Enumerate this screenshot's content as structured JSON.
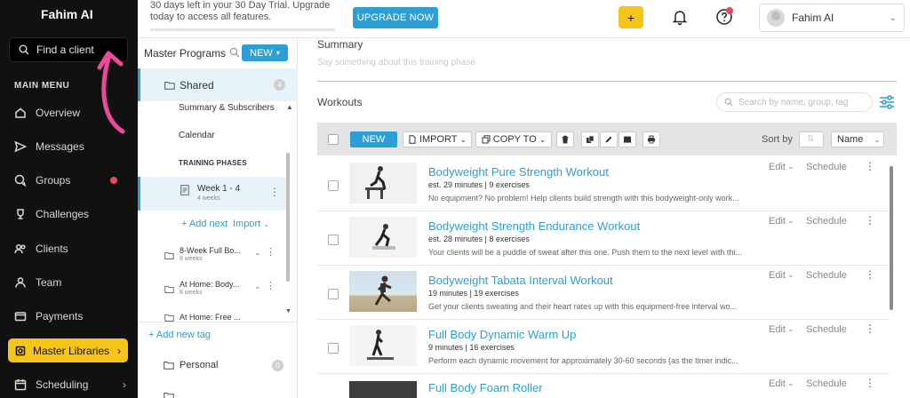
{
  "app": {
    "brand": "Fahim AI"
  },
  "sidebar": {
    "search_placeholder": "Find a client",
    "menu_heading": "MAIN MENU",
    "items": [
      {
        "label": "Overview",
        "icon": "home-icon"
      },
      {
        "label": "Messages",
        "icon": "send-icon"
      },
      {
        "label": "Groups",
        "icon": "chat-icon"
      },
      {
        "label": "Challenges",
        "icon": "trophy-icon"
      },
      {
        "label": "Clients",
        "icon": "users-icon"
      },
      {
        "label": "Team",
        "icon": "team-icon"
      },
      {
        "label": "Payments",
        "icon": "wallet-icon"
      }
    ],
    "active_item": "Master Libraries",
    "bottom_item": "Scheduling"
  },
  "topbar": {
    "trial_text": "30 days left in your 30 Day Trial. Upgrade today to access all features.",
    "upgrade_label": "UPGRADE NOW",
    "plus_label": "+",
    "user_name": "Fahim AI"
  },
  "programs": {
    "heading": "Master Programs",
    "new_label": "NEW",
    "shared": {
      "label": "Shared",
      "count": "4"
    },
    "sub_links": [
      "Summary & Subscribers",
      "Calendar"
    ],
    "phases_heading": "TRAINING PHASES",
    "phase": {
      "title": "Week 1 - 4",
      "sub": "4 weeks"
    },
    "add_next": "+ Add next",
    "import": "Import",
    "list": [
      {
        "title": "8-Week Full Bo...",
        "sub": "8 weeks"
      },
      {
        "title": "At Home: Body...",
        "sub": "8 weeks"
      },
      {
        "title": "At Home: Free ...",
        "sub": "8 weeks"
      }
    ],
    "add_tag": "+ Add new tag",
    "personal": {
      "label": "Personal",
      "count": "0"
    }
  },
  "main": {
    "summary_heading": "Summary",
    "summary_placeholder": "Say something about this training phase",
    "workouts_heading": "Workouts",
    "search_placeholder": "Search by name, group, tag",
    "toolbar": {
      "new": "NEW",
      "import": "IMPORT",
      "copy_to": "COPY TO",
      "sort_by": "Sort by",
      "sort_value": "Name"
    },
    "edit_label": "Edit",
    "schedule_label": "Schedule",
    "workouts": [
      {
        "title": "Bodyweight Pure Strength Workout",
        "meta": "est. 29 minutes | 9 exercises",
        "desc": "No equipment? No problem! Help clients build strength with this bodyweight-only work..."
      },
      {
        "title": "Bodyweight Strength Endurance Workout",
        "meta": "est. 28 minutes | 8 exercises",
        "desc": "Your clients will be a puddle of sweat after this one. Push them to the next level with thi..."
      },
      {
        "title": "Bodyweight Tabata Interval Workout",
        "meta": "19 minutes | 19 exercises",
        "desc": "Get your clients sweating and their heart rates up with this equipment-free interval wo..."
      },
      {
        "title": "Full Body Dynamic Warm Up",
        "meta": "9 minutes | 16 exercises",
        "desc": "Perform each dynamic movement for approximately 30-60 seconds (as the timer indic..."
      },
      {
        "title": "Full Body Foam Roller",
        "meta": "",
        "desc": ""
      }
    ]
  },
  "colors": {
    "accent": "#2b9fd6",
    "brand_yellow": "#f5c518",
    "nav_bg": "#111111",
    "annotation": "#ec4a9a"
  }
}
